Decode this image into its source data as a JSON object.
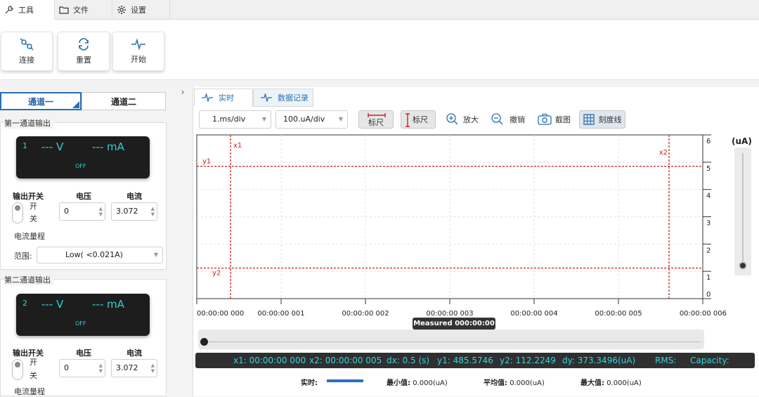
{
  "top_tabs": [
    {
      "label": "工具",
      "icon": "wrench-icon"
    },
    {
      "label": "文件",
      "icon": "folder-icon"
    },
    {
      "label": "设置",
      "icon": "gear-icon"
    }
  ],
  "ribbon": {
    "connect_label": "连接",
    "reset_label": "重置",
    "start_label": "开始"
  },
  "collapse_glyph": "›",
  "channel_tabs": [
    "通道一",
    "通道二"
  ],
  "channel1": {
    "group_title": "第一通道输出",
    "lcd_num": "1",
    "lcd_voltage": "--- V",
    "lcd_current": "--- mA",
    "lcd_state": "OFF",
    "output_switch_label": "输出开关",
    "voltage_label": "电压",
    "current_label": "电流",
    "switch_on": "开",
    "switch_off": "关",
    "voltage_value": "0",
    "current_value": "3.072",
    "range_title": "电流量程",
    "range_label": "范围:",
    "range_value": "Low( <0.021A)"
  },
  "channel2": {
    "group_title": "第二通道输出",
    "lcd_num": "2",
    "lcd_voltage": "--- V",
    "lcd_current": "--- mA",
    "lcd_state": "OFF",
    "output_switch_label": "输出开关",
    "voltage_label": "电压",
    "current_label": "电流",
    "switch_on": "开",
    "switch_off": "关",
    "voltage_value": "0",
    "current_value": "3.072",
    "range_title": "电流量程"
  },
  "view_tabs": [
    {
      "label": "实时",
      "icon": "pulse-icon"
    },
    {
      "label": "数据记录",
      "icon": "pulse-icon"
    }
  ],
  "toolbar": {
    "time_div": "1.ms/div",
    "current_div": "100.uA/div",
    "ruler_h_label": "标尺",
    "ruler_v_label": "标尺",
    "zoom_in_label": "放大",
    "undo_label": "撤销",
    "screenshot_label": "截图",
    "gridlines_label": "刻度线"
  },
  "chart_data": {
    "type": "line",
    "x_ticks": [
      "00:00:00 000",
      "00:00:00 001",
      "00:00:00 002",
      "00:00:00 003",
      "00:00:00 004",
      "00:00:00 005",
      "00:00:00 006"
    ],
    "y_ticks": [
      "0",
      "1",
      "2",
      "3",
      "4",
      "5",
      "6"
    ],
    "ylabel": "(uA)",
    "ylim": [
      0,
      6
    ],
    "xlim": [
      0,
      6
    ],
    "grid": true,
    "series": [],
    "cursors": {
      "x1_label": "x1",
      "x1": 0.4,
      "x2_label": "x2",
      "x2": 5.6,
      "y1_label": "y1",
      "y1": 4.85,
      "y2_label": "y2",
      "y2": 1.12
    },
    "colors": {
      "cursor": "#cc2222",
      "series": "#2a6fc9"
    },
    "measured_label": "Measured 000:00:00"
  },
  "status": {
    "x1": "x1: 00:00:00 000",
    "x2": "x2: 00:00:00 005",
    "dx": "dx: 0.5 (s)",
    "y1": "y1: 485.5746",
    "y2": "y2: 112.2249",
    "dy": "dy: 373.3496(uA)",
    "rms": "RMS:",
    "capacity": "Capacity:"
  },
  "legend": {
    "realtime_label": "实时:",
    "min_label": "最小值:",
    "min_value": "0.000(uA)",
    "avg_label": "平均值:",
    "avg_value": "0.000(uA)",
    "max_label": "最大值:",
    "max_value": "0.000(uA)"
  },
  "slider_level": 0.0,
  "timeline_position": 0.0
}
